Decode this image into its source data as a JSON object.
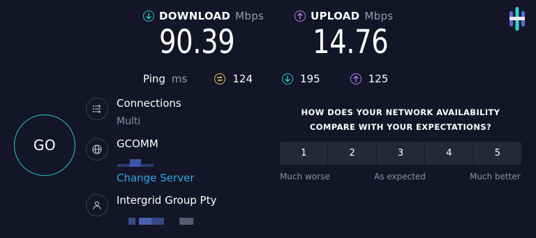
{
  "download": {
    "label": "DOWNLOAD",
    "unit": "Mbps",
    "value": "90.39"
  },
  "upload": {
    "label": "UPLOAD",
    "unit": "Mbps",
    "value": "14.76"
  },
  "ping": {
    "label": "Ping",
    "unit": "ms",
    "idle": "124",
    "download": "195",
    "upload": "125"
  },
  "go_label": "GO",
  "connections": {
    "title": "Connections",
    "mode": "Multi"
  },
  "server": {
    "name": "GCOMM",
    "change_label": "Change Server"
  },
  "provider": {
    "name": "Intergrid Group Pty"
  },
  "survey": {
    "question_line1": "HOW DOES YOUR NETWORK AVAILABILITY",
    "question_line2": "COMPARE WITH YOUR EXPECTATIONS?",
    "options": [
      "1",
      "2",
      "3",
      "4",
      "5"
    ],
    "low_label": "Much worse",
    "mid_label": "As expected",
    "high_label": "Much better"
  },
  "colors": {
    "background": "#141526",
    "download_accent": "#1fd0c8",
    "upload_accent": "#b57cf2",
    "idle_accent": "#f0c36a",
    "link": "#2da8e8"
  }
}
